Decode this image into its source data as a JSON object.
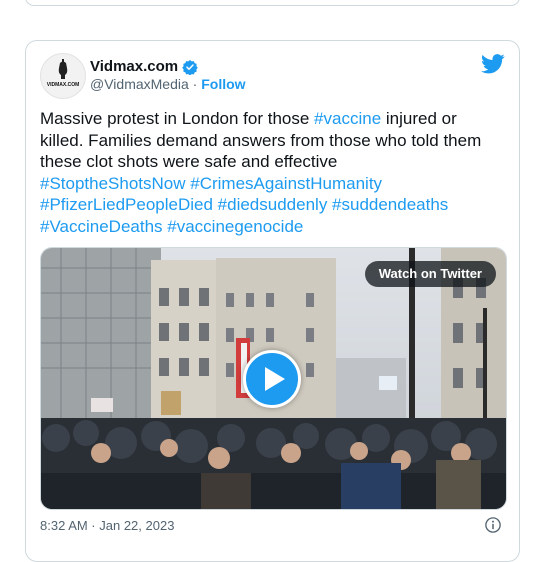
{
  "tweet": {
    "author_name": "Vidmax.com",
    "handle": "@VidmaxMedia",
    "separator": " · ",
    "follow_label": "Follow",
    "avatar_text": "VIDMAX.COM",
    "text_plain_1": "Massive protest in London for those ",
    "hashtag_vaccine": "#vaccine",
    "text_plain_2": " injured or killed. Families demand answers from those who told them these clot shots were safe and effective",
    "hashtags_line1": "#StoptheShotsNow #CrimesAgainstHumanity",
    "hashtags_line2": "#PfizerLiedPeopleDied #diedsuddenly #suddendeaths",
    "hashtags_line3": "#VaccineDeaths #vaccinegenocide",
    "watch_label": "Watch on Twitter",
    "timestamp": "8:32 AM · Jan 22, 2023"
  },
  "icons": {
    "verified": "verified-badge-icon",
    "bird": "twitter-bird-icon",
    "play": "play-icon",
    "info": "info-icon"
  },
  "colors": {
    "accent": "#1d9bf0",
    "text": "#0f1419",
    "secondary": "#536471",
    "border": "#cfd9de"
  }
}
